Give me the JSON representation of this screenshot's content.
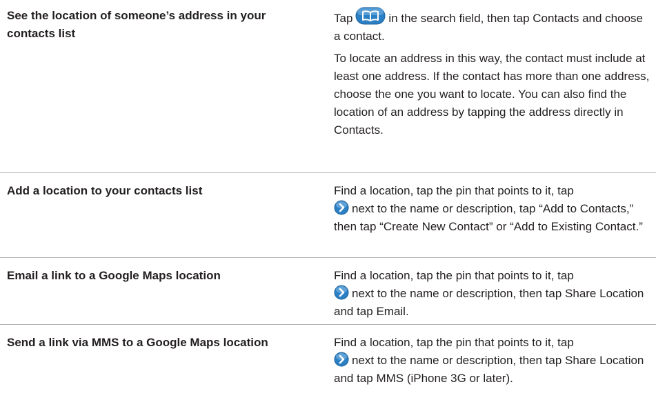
{
  "rows": [
    {
      "term": "See the location of someone’s address in your\ncontacts list",
      "desc_before": "Tap",
      "desc_after": "in the search field, then tap Contacts and choose a contact.",
      "desc_note": "To locate an address in this way, the contact must include at least one address. If the contact has more than one address, choose the one you want to locate. You can also find the location of an address by tapping the address directly in Contacts."
    },
    {
      "term": "Add a location to your contacts list",
      "desc_before": "Find a location, tap the pin that points to it, tap",
      "desc_after": "next to the name or description, tap “Add to Contacts,” then tap “Create New Contact” or “Add to Existing Contact.”"
    },
    {
      "term": "Email a link to a Google Maps location",
      "desc_before": "Find a location, tap the pin that points to it, tap",
      "desc_after": "next to the name or description, then tap Share Location and tap Email."
    },
    {
      "term": "Send a link via MMS to a Google Maps location",
      "desc_before": "Find a location, tap the pin that points to it, tap",
      "desc_after": "next to the name or description, then tap Share Location and tap MMS (iPhone 3G or later)."
    }
  ],
  "icons": {
    "bookmarks": "bookmarks-book-icon",
    "disclosure": "detail-disclosure-arrow-icon",
    "accent": "#1f7cc1"
  }
}
